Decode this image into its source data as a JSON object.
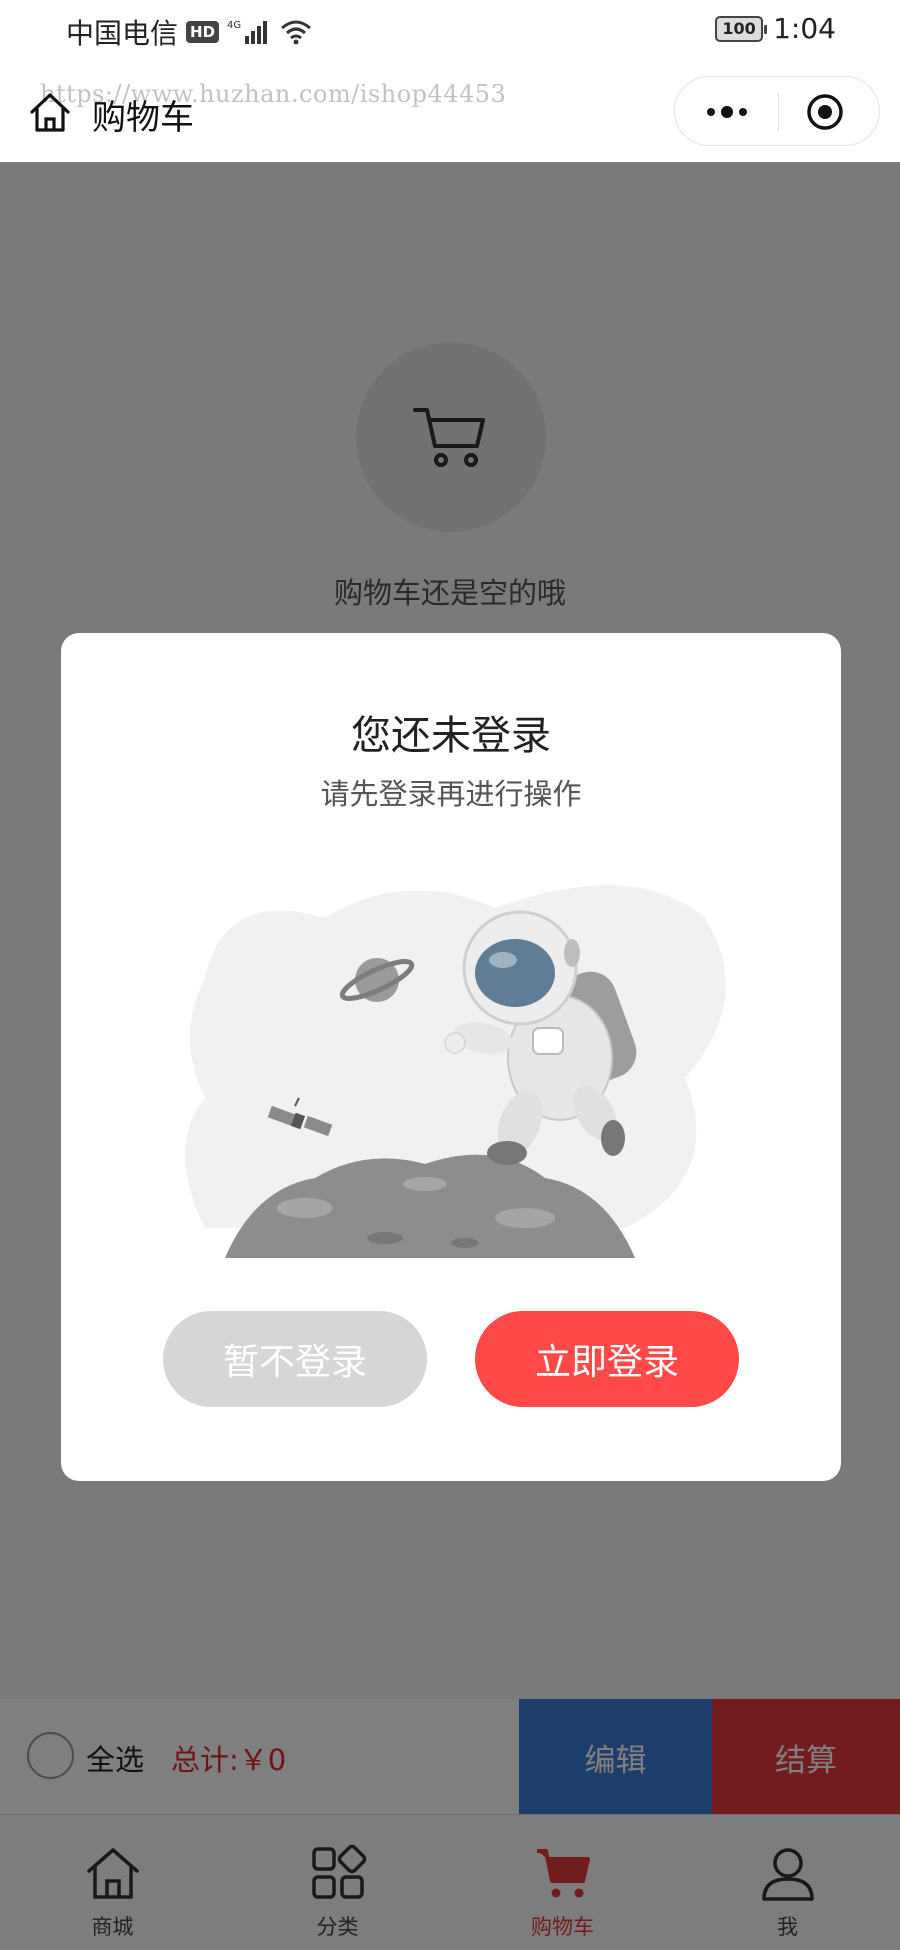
{
  "status_bar": {
    "carrier": "中国电信",
    "hd_badge": "HD",
    "network": "4G",
    "battery": "100",
    "time": "1:04"
  },
  "nav": {
    "title": "购物车",
    "watermark": "https://www.huzhan.com/ishop44453",
    "icons": [
      "home-icon",
      "more-dots-icon",
      "close-target-icon"
    ]
  },
  "cart": {
    "empty_text": "购物车还是空的哦",
    "icon": "cart-icon"
  },
  "action_bar": {
    "select_all": "全选",
    "total": "总计:￥0",
    "edit": "编辑",
    "checkout": "结算"
  },
  "tabs": [
    {
      "label": "商城",
      "icon": "home-icon"
    },
    {
      "label": "分类",
      "icon": "category-grid-icon"
    },
    {
      "label": "购物车",
      "icon": "cart-icon",
      "active": true
    },
    {
      "label": "我",
      "icon": "user-icon"
    }
  ],
  "modal": {
    "title": "您还未登录",
    "subtitle": "请先登录再进行操作",
    "later_button": "暂不登录",
    "login_button": "立即登录",
    "illustration": "astronaut-space-illustration"
  },
  "colors": {
    "accent_red": "#e5383a",
    "login_red": "#ff4848",
    "edit_blue": "#3a7bd5",
    "overlay": "rgba(0,0,0,0.5)"
  }
}
